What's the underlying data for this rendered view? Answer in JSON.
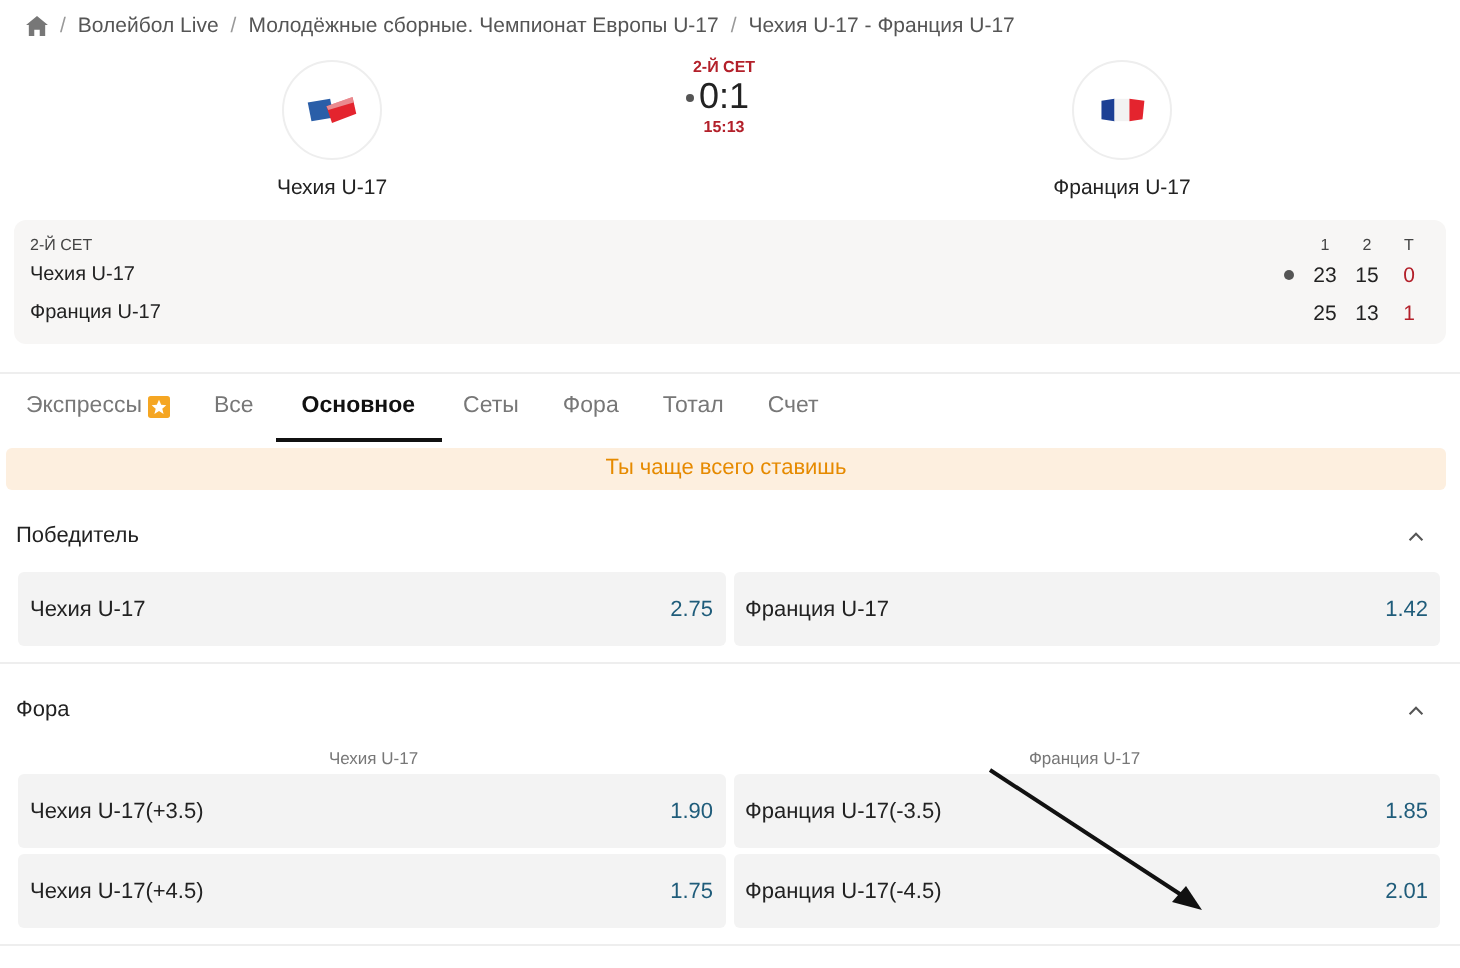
{
  "breadcrumb_separator": "/",
  "breadcrumb": [
    "Волейбол Live",
    "Молодёжные сборные. Чемпионат Европы U-17",
    "Чехия U-17 - Франция U-17"
  ],
  "match": {
    "home": {
      "name": "Чехия U-17"
    },
    "away": {
      "name": "Франция U-17"
    },
    "period": "2-Й СЕТ",
    "score": "0:1",
    "serving_home": true,
    "time": "15:13"
  },
  "scoreboard": {
    "period": "2-Й СЕТ",
    "columns": [
      "1",
      "2",
      "Т"
    ],
    "rows": [
      {
        "team": "Чехия U-17",
        "serving": true,
        "sets": [
          "23",
          "15"
        ],
        "total": "0"
      },
      {
        "team": "Франция U-17",
        "serving": false,
        "sets": [
          "25",
          "13"
        ],
        "total": "1"
      }
    ]
  },
  "tabs": [
    {
      "label": "Экспрессы",
      "selected": false,
      "badge": true
    },
    {
      "label": "Все",
      "selected": false,
      "badge": false
    },
    {
      "label": "Основное",
      "selected": true,
      "badge": false
    },
    {
      "label": "Сеты",
      "selected": false,
      "badge": false
    },
    {
      "label": "Фора",
      "selected": false,
      "badge": false
    },
    {
      "label": "Тотал",
      "selected": false,
      "badge": false
    },
    {
      "label": "Счет",
      "selected": false,
      "badge": false
    }
  ],
  "banner": "Ты чаще всего ставишь",
  "markets": [
    {
      "title": "Победитель",
      "expanded": true,
      "rows": [
        [
          {
            "label": "Чехия U-17",
            "odds": "2.75"
          },
          {
            "label": "Франция U-17",
            "odds": "1.42"
          }
        ]
      ]
    },
    {
      "title": "Фора",
      "expanded": true,
      "columns": [
        "Чехия U-17",
        "Франция U-17"
      ],
      "rows": [
        [
          {
            "label": "Чехия U-17(+3.5)",
            "odds": "1.90"
          },
          {
            "label": "Франция U-17(-3.5)",
            "odds": "1.85"
          }
        ],
        [
          {
            "label": "Чехия U-17(+4.5)",
            "odds": "1.75"
          },
          {
            "label": "Франция U-17(-4.5)",
            "odds": "2.01"
          }
        ]
      ]
    }
  ]
}
